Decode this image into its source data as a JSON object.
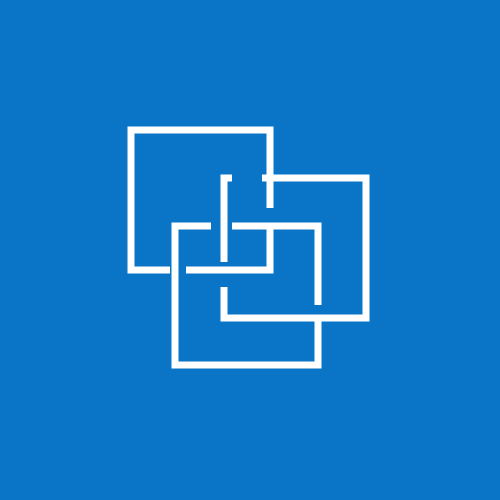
{
  "tile": {
    "background_color": "#0A75C6",
    "icon": "interlocking-squares-logo-icon",
    "icon_color": "#FFFFFF"
  }
}
